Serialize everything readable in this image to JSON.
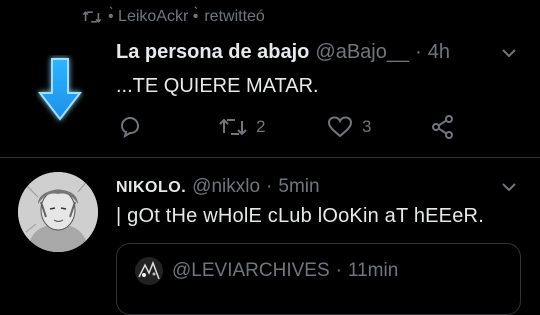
{
  "retweet": {
    "icon": "retweet-icon",
    "user": "•̀ LeikoAckr •̀",
    "action": "retwitteó"
  },
  "tweet1": {
    "author_name": "La persona de abajo",
    "handle": "@aBajo__",
    "separator": "·",
    "time": "4h",
    "text": "...TE QUIERE MATAR.",
    "arrow_color": "#2fb4ff",
    "actions": {
      "reply_count": "",
      "retweet_count": "2",
      "like_count": "3"
    }
  },
  "tweet2": {
    "author_name": "NIKOLO.",
    "handle": "@nikxlo",
    "separator": "·",
    "time": "5min",
    "text": "| gOt tHe wHolE cLub lOoKin aT hEEeR.",
    "quote": {
      "handle": "@LEVIARCHIVES",
      "separator": "·",
      "time": "11min"
    }
  },
  "colors": {
    "background": "#000000",
    "text": "#e7e9ea",
    "muted": "#71767b",
    "border": "#2f3336"
  }
}
